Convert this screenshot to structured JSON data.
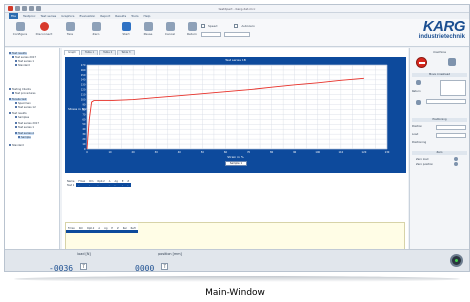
{
  "window": {
    "title": "testXpert - Karg.dat.mcc"
  },
  "menu": {
    "items": [
      "File",
      "Testproc",
      "Test series",
      "Graphics",
      "Evaluation",
      "Report",
      "Results",
      "Tools",
      "Help"
    ],
    "active_index": 0
  },
  "ribbon": {
    "buttons": [
      {
        "label": "Configure",
        "icon": "gear-icon"
      },
      {
        "label": "Disconnect",
        "icon": "stop-icon"
      },
      {
        "label": "Tare",
        "icon": "tare-icon"
      },
      {
        "label": "Zero",
        "icon": "zero-icon"
      },
      {
        "label": "Start",
        "icon": "start-icon"
      },
      {
        "label": "Pause",
        "icon": "pause-icon"
      },
      {
        "label": "Cancel",
        "icon": "cancel-icon"
      },
      {
        "label": "Return",
        "icon": "return-icon"
      }
    ],
    "speed_label": "Speed",
    "autozero_label": "Autozero"
  },
  "logo": {
    "line1": "KARG",
    "line2": "industrietechnik"
  },
  "tree": {
    "items": [
      {
        "label": "Test results",
        "selected": true
      },
      {
        "label": "Test series 2017",
        "selected": false
      },
      {
        "label": "Test series 1",
        "selected": false
      },
      {
        "label": "Standard",
        "selected": false
      },
      {
        "label": "Testing Clients",
        "selected": false
      },
      {
        "label": "Test procedures",
        "selected": false
      },
      {
        "label": "Tensile test",
        "selected": true
      },
      {
        "label": "Specimen",
        "selected": false
      },
      {
        "label": "Test series 12",
        "selected": false
      },
      {
        "label": "Test results",
        "selected": false
      },
      {
        "label": "Samples",
        "selected": false
      },
      {
        "label": "Test series 2017",
        "selected": false
      },
      {
        "label": "Test series 1",
        "selected": false
      },
      {
        "label": "Test series A",
        "selected": true
      },
      {
        "label": "Sample",
        "selected": true
      },
      {
        "label": "Standard",
        "selected": false
      }
    ]
  },
  "center": {
    "tabs": [
      "Graph",
      "Table 1",
      "Table 2",
      "Table 3"
    ],
    "active_tab": 0,
    "results_headers": [
      "Name",
      "Fmax",
      "Rm",
      "Rp0.2",
      "A",
      "Ag",
      "E",
      "Z"
    ],
    "results_rows": [
      {
        "label": "Test 1",
        "values": [
          "-",
          "-",
          "-",
          "-",
          "-",
          "-",
          "-",
          "-"
        ]
      }
    ],
    "results2_headers": [
      "Fmax",
      "Rm",
      "Rp0.2",
      "A",
      "Ag",
      "E",
      "Z",
      "Rel",
      "ReH"
    ]
  },
  "right_panel": {
    "title": "machine",
    "sections": [
      "Move crosshead",
      "Positioning",
      "Zero"
    ],
    "labels": [
      "Return",
      "Position",
      "Load",
      "Positioning",
      "Zero load",
      "Zero position"
    ]
  },
  "status": {
    "load_label": "load [N]",
    "load_value": "-0036",
    "position_label": "position [mm]",
    "position_value": "0000",
    "button_label": "T"
  },
  "caption": "Main-Window",
  "chart_data": {
    "type": "line",
    "title": "Test series 1B",
    "xlabel": "Strain in %",
    "ylabel": "Stress in N/mm²",
    "legend": [
      "Sample 1"
    ],
    "grid": true,
    "series": [
      {
        "name": "Sample 1",
        "x": [
          0,
          1,
          2,
          3,
          5,
          10,
          20,
          30,
          40,
          50,
          60,
          70,
          80,
          90,
          100,
          110,
          120
        ],
        "y": [
          0,
          60,
          95,
          98,
          98,
          98,
          100,
          104,
          108,
          112,
          116,
          120,
          125,
          130,
          134,
          139,
          143
        ]
      }
    ],
    "xlim": [
      0,
      130
    ],
    "ylim": [
      0,
      170
    ],
    "x_ticks": [
      0,
      5,
      10,
      15,
      20,
      25,
      30,
      35,
      40,
      45,
      50,
      55,
      60,
      65,
      70,
      75,
      80,
      85,
      90,
      95,
      100,
      105,
      110,
      115,
      120,
      125,
      130
    ],
    "y_ticks": [
      0,
      10,
      20,
      30,
      40,
      50,
      60,
      70,
      80,
      90,
      100,
      110,
      120,
      130,
      140,
      150,
      160,
      170
    ]
  }
}
